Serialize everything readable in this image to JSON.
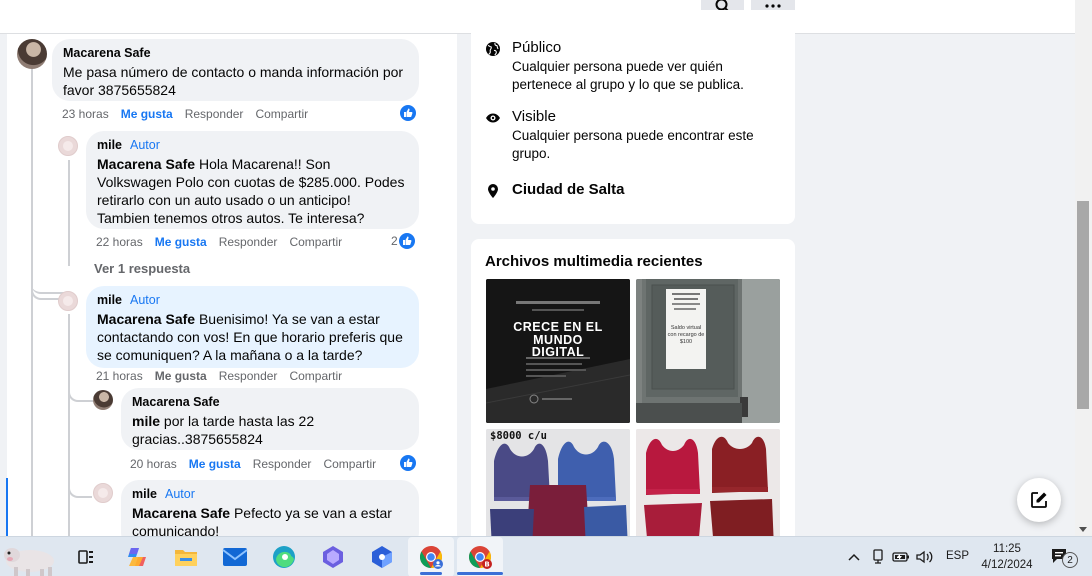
{
  "comments": [
    {
      "author": "Macarena Safe",
      "badge": "",
      "mention": "",
      "text": "Me pasa número de contacto o manda información por favor 3875655824",
      "time": "23 horas",
      "like": "Me gusta",
      "reply": "Responder",
      "share": "Compartir",
      "reactions": ""
    },
    {
      "author": "mile",
      "badge": "Autor",
      "mention": "Macarena Safe",
      "text": " Hola Macarena!! Son Volkswagen Polo con cuotas de $285.000. Podes retirarlo con un auto usado o un anticipo! Tambien tenemos otros autos. Te interesa?",
      "time": "22 horas",
      "like": "Me gusta",
      "reply": "Responder",
      "share": "Compartir",
      "reactions": "2"
    },
    {
      "author": "mile",
      "badge": "Autor",
      "mention": "Macarena Safe",
      "text": " Buenisimo! Ya se van a estar contactando con vos! En que horario preferis que se comuniquen? A la mañana o a la tarde?",
      "time": "21 horas",
      "like": "Me gusta",
      "reply": "Responder",
      "share": "Compartir",
      "reactions": ""
    },
    {
      "author": "Macarena Safe",
      "badge": "",
      "mention": "mile",
      "text": " por la tarde hasta las 22 gracias..3875655824",
      "time": "20 horas",
      "like": "Me gusta",
      "reply": "Responder",
      "share": "Compartir",
      "reactions": ""
    },
    {
      "author": "mile",
      "badge": "Autor",
      "mention": "Macarena Safe",
      "text": " Pefecto ya se van a estar comunicando!",
      "time": "",
      "like": "",
      "reply": "",
      "share": "",
      "reactions": ""
    }
  ],
  "view_replies": "Ver 1 respuesta",
  "about": [
    {
      "title": "Público",
      "desc": "Cualquier persona puede ver quién pertenece al grupo y lo que se publica.",
      "icon": "globe-icon"
    },
    {
      "title": "Visible",
      "desc": "Cualquier persona puede encontrar este grupo.",
      "icon": "eye-icon"
    },
    {
      "title": "Ciudad de Salta",
      "desc": "",
      "icon": "location-pin-icon"
    }
  ],
  "media": {
    "title": "Archivos multimedia recientes",
    "thumb1": {
      "line1": "CRECE EN EL",
      "line2": "MUNDO",
      "line3": "DIGITAL"
    },
    "thumb2": {
      "text": "Saldo virtual con recargo de $100"
    },
    "thumb3": {
      "price": "$8000 c/u"
    }
  },
  "taskbar": {
    "lang": "ESP",
    "time": "11:25",
    "date": "4/12/2024",
    "notifications": "2"
  },
  "colors": {
    "accent": "#1877f2",
    "bubble": "#f0f2f5",
    "highlight": "#e7f3ff"
  }
}
